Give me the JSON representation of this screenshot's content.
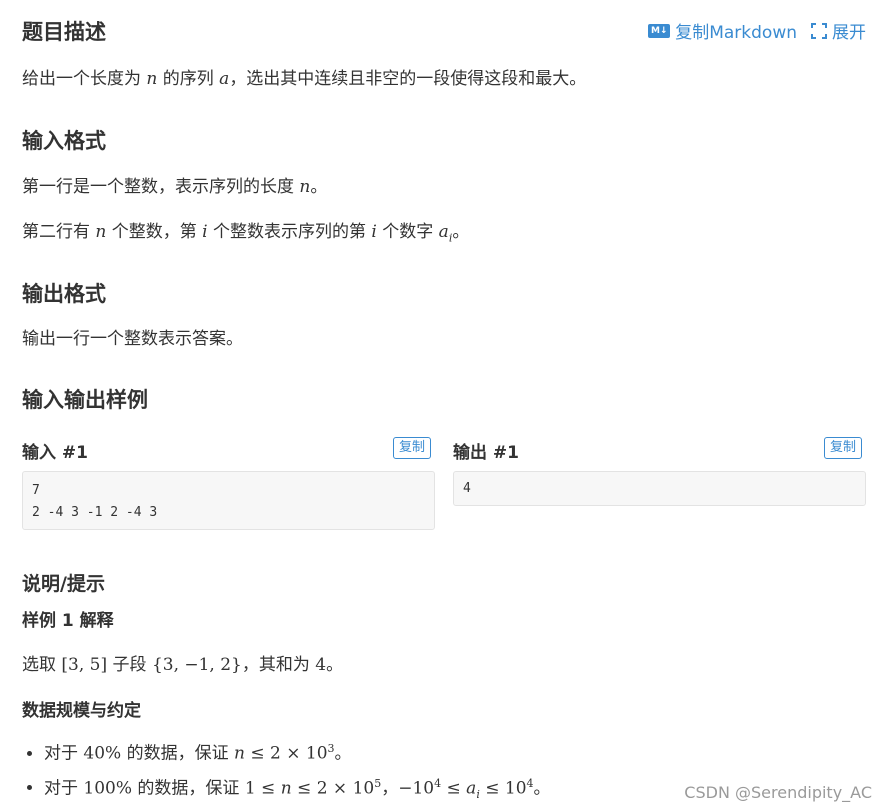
{
  "toolbar": {
    "md_icon": "M↓",
    "copy_markdown_label": "复制Markdown",
    "expand_label": "展开"
  },
  "description": {
    "title": "题目描述",
    "text_prefix": "给出一个长度为 ",
    "n": "n",
    "text_mid": " 的序列 ",
    "a": "a",
    "text_suffix": "，选出其中连续且非空的一段使得这段和最大。"
  },
  "input_format": {
    "title": "输入格式",
    "line1_prefix": "第一行是一个整数，表示序列的长度 ",
    "line1_var": "n",
    "line1_suffix": "。",
    "line2_a": "第二行有 ",
    "line2_n": "n",
    "line2_b": " 个整数，第 ",
    "line2_i": "i",
    "line2_c": " 个整数表示序列的第 ",
    "line2_i2": "i",
    "line2_d": " 个数字 ",
    "line2_ai": "a",
    "line2_ai_sub": "i",
    "line2_e": "。"
  },
  "output_format": {
    "title": "输出格式",
    "text": "输出一行一个整数表示答案。"
  },
  "samples": {
    "title": "输入输出样例",
    "input_label": "输入 #1",
    "output_label": "输出 #1",
    "copy_label": "复制",
    "input_code": "7\n2 -4 3 -1 2 -4 3",
    "output_code": "4"
  },
  "hints": {
    "title": "说明/提示",
    "sample_explain_title": "样例 1 解释",
    "explain_a": "选取 ",
    "explain_range": "[3, 5]",
    "explain_b": " 子段 ",
    "explain_set": "{3, −1, 2}",
    "explain_c": "，其和为 ",
    "explain_sum": "4",
    "explain_d": "。",
    "limits_title": "数据规模与约定",
    "limit1_a": "对于 ",
    "limit1_pct": "40%",
    "limit1_b": " 的数据，保证 ",
    "limit1_n": "n",
    "limit1_le": " ≤ 2 × 10",
    "limit1_exp": "3",
    "limit1_c": "。",
    "limit2_a": "对于 ",
    "limit2_pct": "100%",
    "limit2_b": " 的数据，保证 ",
    "limit2_one": "1 ≤ ",
    "limit2_n": "n",
    "limit2_le": " ≤ 2 × 10",
    "limit2_exp": "5",
    "limit2_c": "，",
    "limit2_neg": "−10",
    "limit2_exp2": "4",
    "limit2_le2": " ≤ ",
    "limit2_ai": "a",
    "limit2_ai_sub": "i",
    "limit2_le3": " ≤ 10",
    "limit2_exp3": "4",
    "limit2_d": "。"
  },
  "watermark": "CSDN @Serendipity_AC"
}
